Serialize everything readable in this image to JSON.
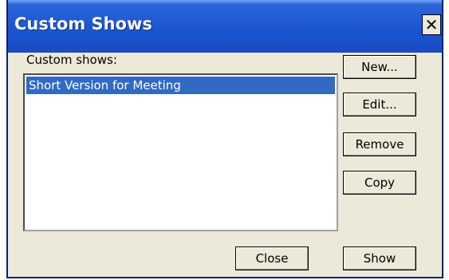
{
  "window": {
    "title": "Custom Shows",
    "close_glyph": "✕"
  },
  "list": {
    "label": "Custom shows:",
    "items": [
      {
        "label": "Short Version for Meeting",
        "selected": true
      }
    ]
  },
  "buttons": {
    "new": "New...",
    "edit": "Edit...",
    "remove": "Remove",
    "copy": "Copy",
    "close": "Close",
    "show": "Show"
  },
  "colors": {
    "titlebar": "#1954d1",
    "dialog_bg": "#ece9d8",
    "selection": "#316ac5"
  }
}
